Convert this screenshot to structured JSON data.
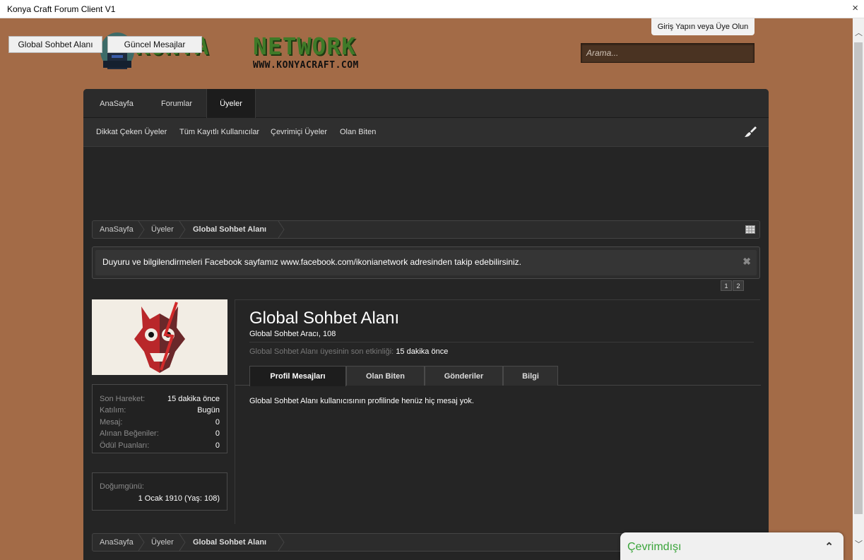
{
  "window": {
    "title": "Konya Craft Forum Client V1",
    "close": "×"
  },
  "app_buttons": {
    "global": "Global Sohbet Alanı",
    "recent": "Güncel Mesajlar"
  },
  "logo": {
    "word1": "KONYA",
    "word2": "NETWORK",
    "url": "WWW.KONYACRAFT.COM"
  },
  "header": {
    "login_label": "Giriş Yapın veya Üye Olun",
    "search_placeholder": "Arama..."
  },
  "nav": {
    "tabs": [
      "AnaSayfa",
      "Forumlar",
      "Üyeler"
    ],
    "active": "Üyeler"
  },
  "subnav": {
    "items": [
      "Dikkat Çeken Üyeler",
      "Tüm Kayıtlı Kullanıcılar",
      "Çevrimiçi Üyeler",
      "Olan Biten"
    ]
  },
  "breadcrumb": {
    "items": [
      "AnaSayfa",
      "Üyeler",
      "Global Sohbet Alanı"
    ]
  },
  "notice": {
    "text": "Duyuru ve bilgilendirmeleri Facebook sayfamız www.facebook.com/ikonianetwork adresinden takip edebilirsiniz.",
    "close": "✖"
  },
  "notice_pages": [
    "1",
    "2"
  ],
  "profile": {
    "name": "Global Sohbet Alanı",
    "subtitle": "Global Sohbet Aracı, 108",
    "activity_label": "Global Sohbet Alanı üyesinin son etkinliği:",
    "activity_value": "15 dakika önce",
    "tabs": [
      "Profil Mesajları",
      "Olan Biten",
      "Gönderiler",
      "Bilgi"
    ],
    "empty_message": "Global Sohbet Alanı kullanıcısının profilinde henüz hiç mesaj yok."
  },
  "stats": [
    {
      "label": "Son Hareket:",
      "value": "15 dakika önce"
    },
    {
      "label": "Katılım:",
      "value": "Bugün"
    },
    {
      "label": "Mesaj:",
      "value": "0"
    },
    {
      "label": "Alınan Beğeniler:",
      "value": "0"
    },
    {
      "label": "Ödül Puanları:",
      "value": "0"
    }
  ],
  "birthday": {
    "label": "Doğumgünü:",
    "value": "1 Ocak 1910 (Yaş: 108)"
  },
  "chat": {
    "status": "Çevrimdışı",
    "chevron": "⌃"
  },
  "colors": {
    "page_bg": "#a36b47",
    "panel_bg": "#252525",
    "online_green": "#3aa43a"
  },
  "icons": [
    "brush-icon",
    "calendar-icon",
    "close-icon",
    "chevron-up-icon"
  ]
}
